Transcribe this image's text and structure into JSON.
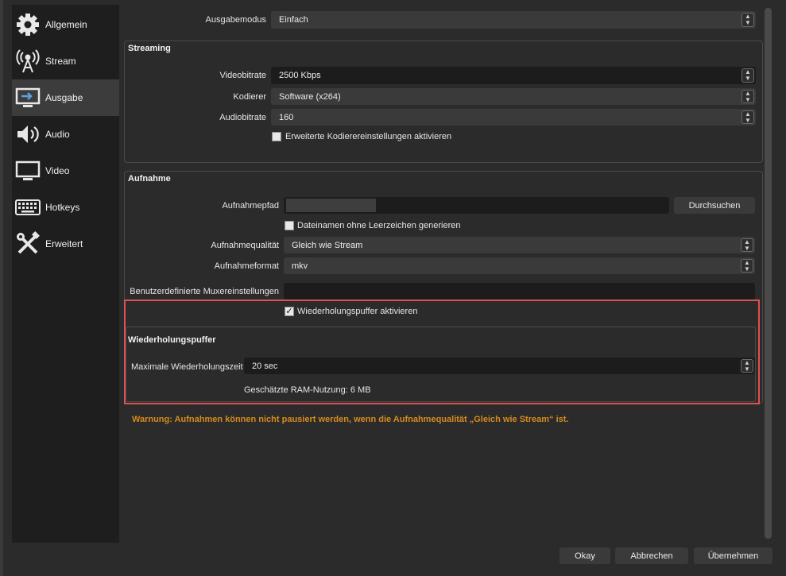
{
  "sidebar": {
    "items": [
      {
        "label": "Allgemein",
        "icon": "gear-icon"
      },
      {
        "label": "Stream",
        "icon": "broadcast-tower-icon"
      },
      {
        "label": "Ausgabe",
        "icon": "output-monitor-icon",
        "active": true
      },
      {
        "label": "Audio",
        "icon": "speaker-icon"
      },
      {
        "label": "Video",
        "icon": "monitor-icon"
      },
      {
        "label": "Hotkeys",
        "icon": "keyboard-icon"
      },
      {
        "label": "Erweitert",
        "icon": "tools-icon"
      }
    ]
  },
  "output_mode": {
    "label": "Ausgabemodus",
    "value": "Einfach"
  },
  "streaming": {
    "title": "Streaming",
    "video_bitrate": {
      "label": "Videobitrate",
      "value": "2500 Kbps"
    },
    "encoder": {
      "label": "Kodierer",
      "value": "Software (x264)"
    },
    "audio_bitrate": {
      "label": "Audiobitrate",
      "value": "160"
    },
    "advanced_encoder": {
      "label": "Erweiterte Kodierereinstellungen aktivieren",
      "checked": false
    }
  },
  "recording": {
    "title": "Aufnahme",
    "path": {
      "label": "Aufnahmepfad",
      "value": ""
    },
    "browse_label": "Durchsuchen",
    "no_spaces": {
      "label": "Dateinamen ohne Leerzeichen generieren",
      "checked": false
    },
    "quality": {
      "label": "Aufnahmequalität",
      "value": "Gleich wie Stream"
    },
    "format": {
      "label": "Aufnahmeformat",
      "value": "mkv"
    },
    "muxer": {
      "label": "Benutzerdefinierte Muxereinstellungen",
      "value": ""
    },
    "replay_enable": {
      "label": "Wiederholungspuffer aktivieren",
      "checked": true
    }
  },
  "replay_buffer": {
    "title": "Wiederholungspuffer",
    "max_time": {
      "label": "Maximale Wiederholungszeit",
      "value": "20 sec"
    },
    "ram_usage": "Geschätzte RAM-Nutzung: 6 MB"
  },
  "warning": "Warnung: Aufnahmen können nicht pausiert werden, wenn die Aufnahmequalität „Gleich wie Stream“ ist.",
  "buttons": {
    "okay": "Okay",
    "cancel": "Abbrechen",
    "apply": "Übernehmen"
  },
  "colors": {
    "highlight": "#e05050",
    "warning": "#d58a1f"
  }
}
